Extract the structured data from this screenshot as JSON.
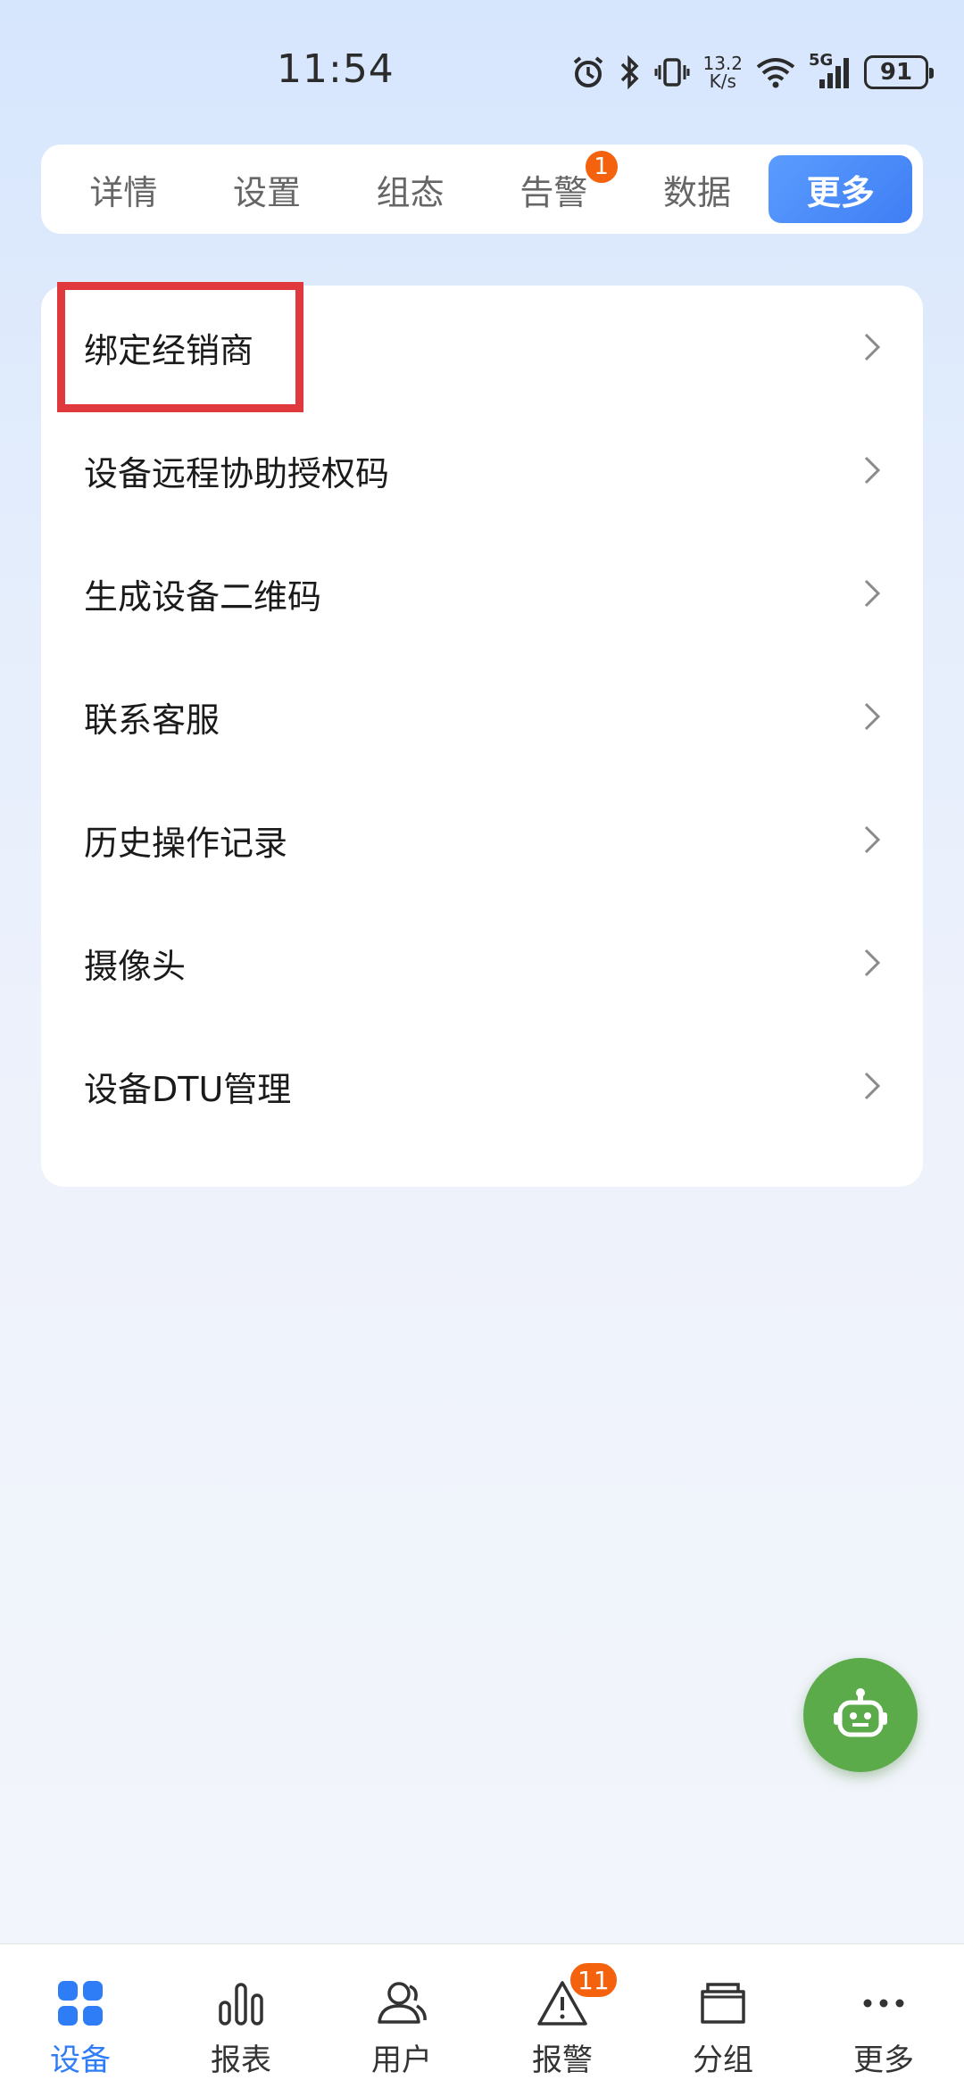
{
  "status_bar": {
    "time": "11:54",
    "net_speed_value": "13.2",
    "net_speed_unit": "K/s",
    "network_type": "5G",
    "battery": "91"
  },
  "tabs": [
    {
      "label": "详情",
      "active": false
    },
    {
      "label": "设置",
      "active": false
    },
    {
      "label": "组态",
      "active": false
    },
    {
      "label": "告警",
      "active": false,
      "badge": "1"
    },
    {
      "label": "数据",
      "active": false
    },
    {
      "label": "更多",
      "active": true
    }
  ],
  "menu": {
    "items": [
      {
        "label": "绑定经销商"
      },
      {
        "label": "设备远程协助授权码"
      },
      {
        "label": "生成设备二维码"
      },
      {
        "label": "联系客服"
      },
      {
        "label": "历史操作记录"
      },
      {
        "label": "摄像头"
      },
      {
        "label": "设备DTU管理"
      }
    ]
  },
  "bottom_nav": [
    {
      "label": "设备",
      "icon": "grid-icon",
      "active": true
    },
    {
      "label": "报表",
      "icon": "bar-chart-icon",
      "active": false
    },
    {
      "label": "用户",
      "icon": "users-icon",
      "active": false
    },
    {
      "label": "报警",
      "icon": "warning-icon",
      "active": false,
      "badge": "11"
    },
    {
      "label": "分组",
      "icon": "folder-icon",
      "active": false
    },
    {
      "label": "更多",
      "icon": "more-icon",
      "active": false
    }
  ],
  "colors": {
    "accent": "#2f7df6",
    "badge": "#f4620e",
    "fab": "#5cab4a",
    "highlight": "#e0393d"
  }
}
